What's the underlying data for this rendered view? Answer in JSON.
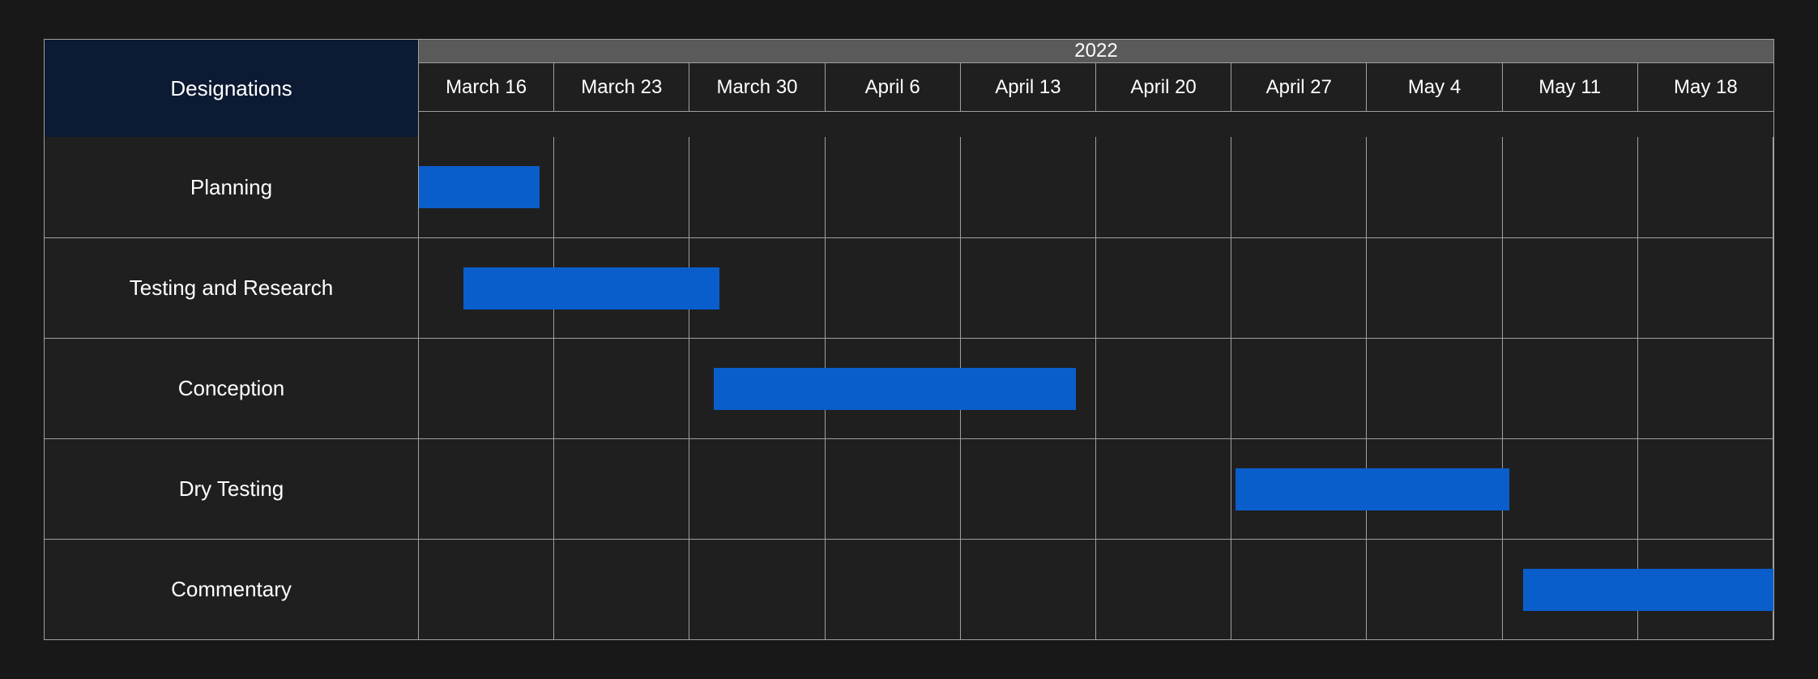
{
  "chart_data": {
    "type": "gantt",
    "title": "",
    "year": "2022",
    "row_header": "Designations",
    "columns": [
      "March 16",
      "March 23",
      "March 30",
      "April 6",
      "April 13",
      "April 20",
      "April 27",
      "May 4",
      "May 11",
      "May 18"
    ],
    "rows": [
      {
        "label": "Planning",
        "start_pct": 0.0,
        "end_pct": 8.9
      },
      {
        "label": "Testing and Research",
        "start_pct": 3.3,
        "end_pct": 22.2
      },
      {
        "label": "Conception",
        "start_pct": 21.8,
        "end_pct": 48.5
      },
      {
        "label": "Dry Testing",
        "start_pct": 60.3,
        "end_pct": 80.5
      },
      {
        "label": "Commentary",
        "start_pct": 81.5,
        "end_pct": 100.0
      }
    ],
    "bar_color": "#0a5ecb"
  }
}
